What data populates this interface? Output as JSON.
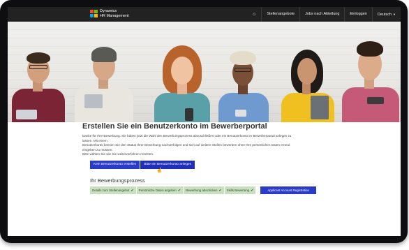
{
  "app": {
    "logo_line1": "Dynamics",
    "logo_line2": "HR Management"
  },
  "nav": {
    "home_icon": "home-icon",
    "items": [
      "Stellenangebote",
      "Jobs nach Abteilung",
      "Einloggen",
      "Deutsch"
    ]
  },
  "hero": {
    "description": "Banner photo of six smiling people against a white brick wall"
  },
  "main": {
    "title": "Erstellen Sie ein Benutzerkonto im Bewerberportal",
    "intro_line1": "Danke für Ihre Bewerbung. Sie haben jetzt die Wahl den Bewerbungsprozess abzuschließen oder ein Benutzerkonto im Bewerberportal anlegen zu lassen. Mit einem",
    "intro_line2": "Benutzerkonto können Sie den Status Ihrer Bewerbung nachverfolgen und sich auf weitere Stellen bewerben ohne Ihre persönlichen Daten erneut eingeben zu müssen.",
    "intro_line3": "Bitte wählen Sie wie Sie weiterverfahren möchten.",
    "btn_no_account": "Kein Benutzerkonto erstellen",
    "btn_create_account": "Bitte ein Benutzerkonto anlegen"
  },
  "process": {
    "title": "Ihr Bewerbungsprozess",
    "steps": [
      "Details zum Stellenangebot",
      "Persönliche Daten angeben",
      "Bewerbung abschicken",
      "Skills Bewertung"
    ],
    "current_step": "Applicant Account Registration",
    "check_icon": "check-icon"
  },
  "colors": {
    "navbar": "#222222",
    "primary_button": "#2a3cc7",
    "step_done": "#c8dfc0"
  }
}
